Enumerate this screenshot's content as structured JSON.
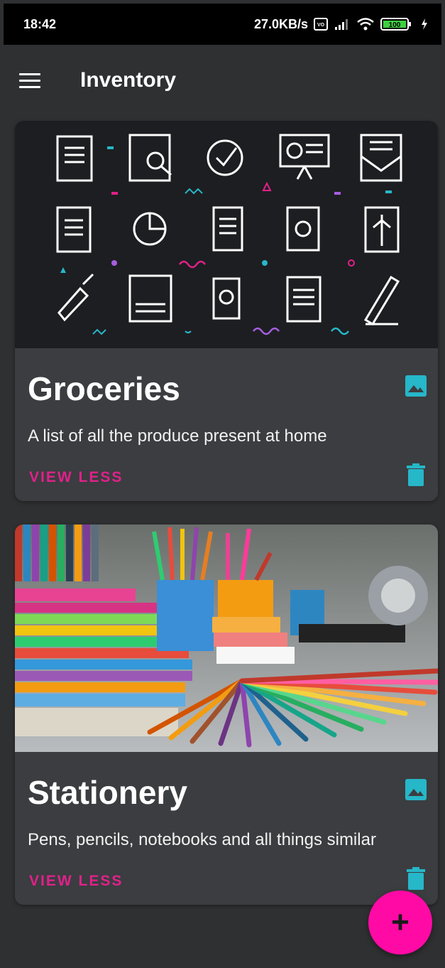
{
  "status_bar": {
    "time": "18:42",
    "net_speed": "27.0KB/s",
    "volte": "VoLTE",
    "battery": "100"
  },
  "app_bar": {
    "title": "Inventory",
    "menu_icon": "menu-icon"
  },
  "cards": [
    {
      "title": "Groceries",
      "description": "A list of all the produce present at home",
      "action_label": "VIEW LESS"
    },
    {
      "title": "Stationery",
      "description": "Pens, pencils, notebooks and all things similar",
      "action_label": "VIEW LESS"
    }
  ],
  "fab": {
    "label": "+"
  },
  "colors": {
    "accent": "#e0218a",
    "icon_teal": "#26b7c9",
    "fab": "#ff0aa5",
    "card_bg": "#3b3d40",
    "page_bg": "#2f3032"
  }
}
